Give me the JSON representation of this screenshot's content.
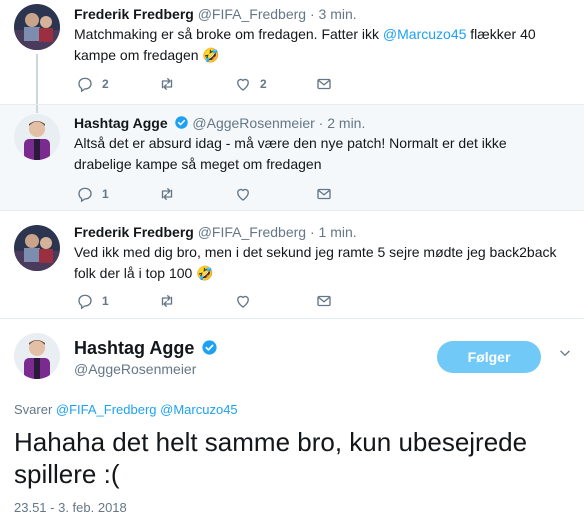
{
  "tweets": [
    {
      "name": "Frederik Fredberg",
      "handle": "@FIFA_Fredberg",
      "time": "3 min.",
      "text_before": "Matchmaking er så broke om fredagen. Fatter ikk ",
      "mention": "@Marcuzo45",
      "text_after": " flækker 40 kampe om fredagen",
      "emoji": "🤣",
      "reply_count": "2",
      "retweet_count": "",
      "like_count": "2",
      "verified": false
    },
    {
      "name": "Hashtag Agge",
      "handle": "@AggeRosenmeier",
      "time": "2 min.",
      "text": "Altså det er absurd idag - må være den nye patch! Normalt er det ikke drabelige kampe så meget om fredagen",
      "reply_count": "1",
      "retweet_count": "",
      "like_count": "",
      "verified": true
    },
    {
      "name": "Frederik Fredberg",
      "handle": "@FIFA_Fredberg",
      "time": "1 min.",
      "text": "Ved ikk med dig bro, men i det sekund jeg ramte 5 sejre mødte jeg back2back folk der lå i top 100",
      "emoji": "🤣",
      "reply_count": "1",
      "retweet_count": "",
      "like_count": "",
      "verified": false
    }
  ],
  "main": {
    "name": "Hashtag Agge",
    "handle": "@AggeRosenmeier",
    "follow_label": "Følger",
    "reply_prefix": "Svarer ",
    "reply_mention_1": "@FIFA_Fredberg",
    "reply_mention_2": "@Marcuzo45",
    "text": "Hahaha det helt samme bro, kun ubesejrede spillere :(",
    "date": "23.51 - 3. feb. 2018"
  },
  "colors": {
    "accent": "#1da1f2",
    "muted": "#657786",
    "follow_button": "#71c9f8",
    "thread_bg": "#f5f8fa"
  },
  "icons": [
    "reply-icon",
    "retweet-icon",
    "like-icon",
    "message-icon",
    "verified-icon",
    "chevron-down-icon"
  ]
}
